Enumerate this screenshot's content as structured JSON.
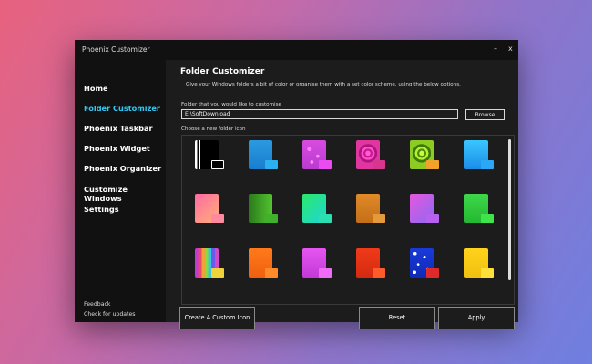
{
  "window": {
    "title": "Phoenix Customizer",
    "minimize_glyph": "–",
    "close_glyph": "x"
  },
  "sidebar": {
    "items": [
      {
        "label": "Home"
      },
      {
        "label": "Folder Customizer",
        "active": true
      },
      {
        "label": "Phoenix Taskbar"
      },
      {
        "label": "Phoenix Widget"
      },
      {
        "label": "Phoenix Organizer"
      },
      {
        "label": "Customize Windows"
      },
      {
        "label": "Settings"
      }
    ],
    "footer": {
      "feedback": "Feedback",
      "updates": "Check for updates"
    }
  },
  "main": {
    "title": "Folder Customizer",
    "description": "Give your Windows folders a bit of color or organise them with a set color scheme, using the below options.",
    "folder_label": "Folder that you would like to customise",
    "folder_value": "E:\\SoftDownload",
    "browse_label": "Browse",
    "icons_label": "Choose a new folder icon",
    "icons": [
      {
        "name": "black-white-stripe"
      },
      {
        "name": "blue"
      },
      {
        "name": "magenta-dots"
      },
      {
        "name": "pink-swirl"
      },
      {
        "name": "lime-swirl"
      },
      {
        "name": "cyan-blue"
      },
      {
        "name": "pink-peach"
      },
      {
        "name": "green-dark"
      },
      {
        "name": "green-cyan"
      },
      {
        "name": "orange-brown"
      },
      {
        "name": "pink-purple"
      },
      {
        "name": "green"
      },
      {
        "name": "rainbow-stripes"
      },
      {
        "name": "orange"
      },
      {
        "name": "magenta"
      },
      {
        "name": "red-orange"
      },
      {
        "name": "blue-stars"
      },
      {
        "name": "yellow"
      }
    ],
    "buttons": {
      "custom_icon": "Create A Custom Icon",
      "reset": "Reset",
      "apply": "Apply"
    }
  },
  "colors": {
    "accent": "#33c8f3"
  }
}
